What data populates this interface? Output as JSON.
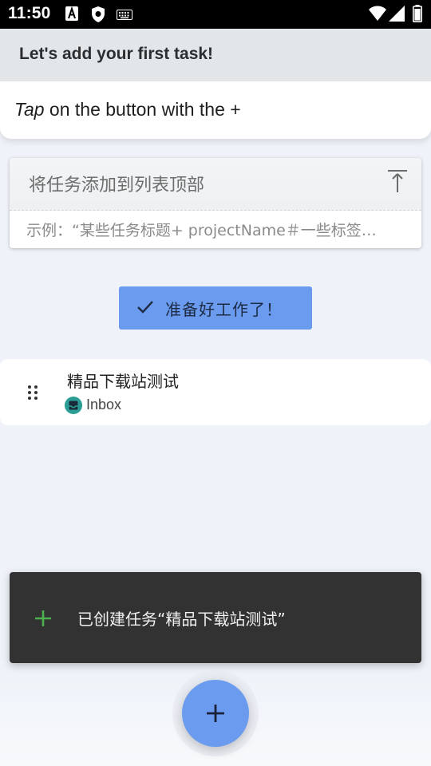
{
  "status_bar": {
    "time": "11:50"
  },
  "tip": {
    "title": "Let's add your first task!",
    "body_em": "Tap",
    "body_rest": " on the button with the +"
  },
  "add_task": {
    "placeholder": "将任务添加到列表顶部",
    "example": "示例：“某些任务标题+ projectName＃一些标签…"
  },
  "ready_button": {
    "label": "准备好工作了！"
  },
  "task": {
    "title": "精品下载站测试",
    "project": "Inbox"
  },
  "snackbar": {
    "message": "已创建任务“精品下载站测试”"
  },
  "colors": {
    "accent": "#6a9bee",
    "snackbar_bg": "#323232",
    "snack_icon": "#4caf50",
    "project_icon": "#2a9d94"
  },
  "icons": {
    "status": [
      "a-notification-icon",
      "shield-icon",
      "keyboard-icon",
      "wifi-icon",
      "signal-icon",
      "battery-icon"
    ],
    "to_top": "vertical-align-top-icon",
    "ready": "check-icon",
    "drag": "drag-handle-icon",
    "project": "inbox-icon",
    "snack": "plus-icon",
    "fab": "plus-icon"
  }
}
